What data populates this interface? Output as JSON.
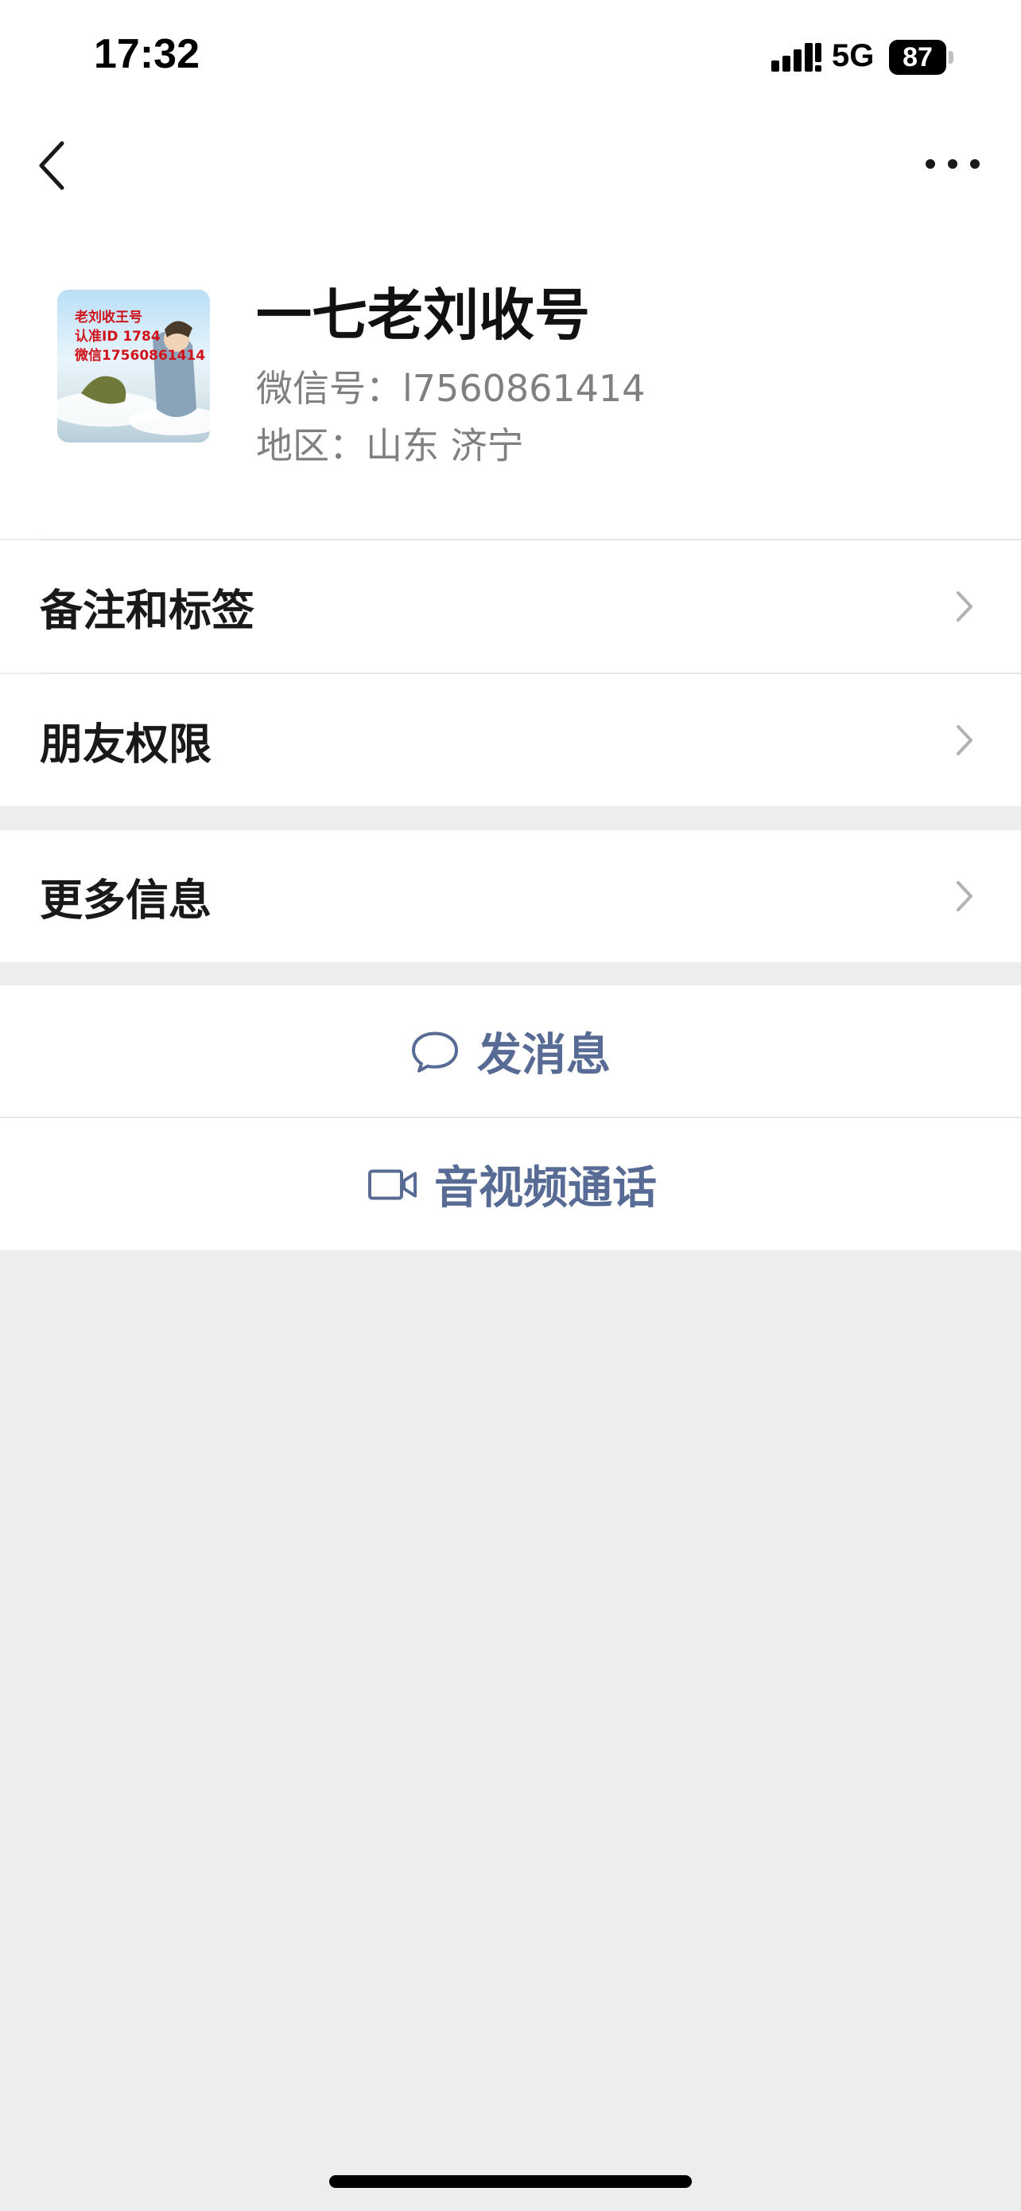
{
  "status_bar": {
    "time": "17:32",
    "network": "5G",
    "battery": "87",
    "battery_level": 0.87
  },
  "nav": {
    "back_icon": "chevron-left-icon",
    "more_icon": "ellipsis-icon"
  },
  "profile": {
    "name": "一七老刘收号",
    "wechat_id": "微信号：l7560861414",
    "region": "地区：山东 济宁",
    "avatar_text": [
      "老刘收王号",
      "认准ID 1784",
      "微信17560861414"
    ]
  },
  "menu": {
    "remarks_tags": "备注和标签",
    "friend_permissions": "朋友权限",
    "more_info": "更多信息"
  },
  "actions": {
    "send_message": "发消息",
    "video_call": "音视频通话"
  },
  "colors": {
    "link": "#576b95",
    "background": "#ededed",
    "card": "#ffffff"
  }
}
